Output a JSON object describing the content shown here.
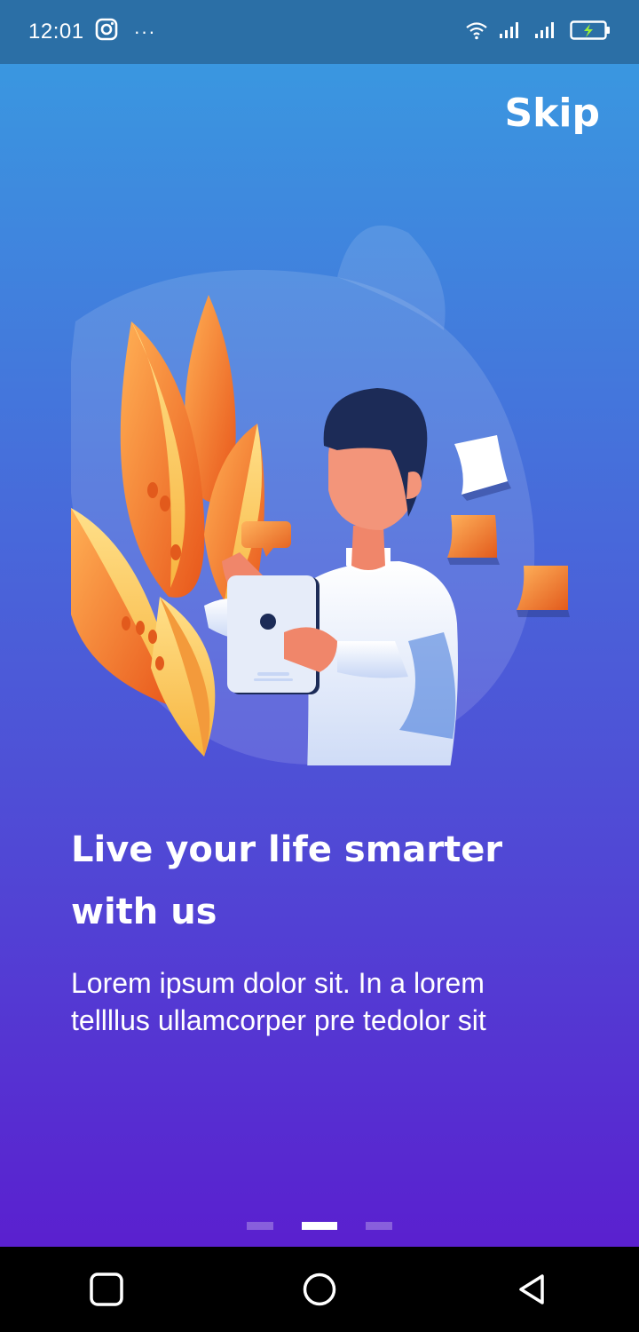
{
  "status_bar": {
    "time": "12:01",
    "overflow": "···",
    "icons": [
      "instagram-icon",
      "wifi-icon",
      "signal-icon",
      "signal-icon",
      "battery-charging-icon"
    ]
  },
  "onboarding": {
    "skip_label": "Skip",
    "headline_line1": "Live your life smarter",
    "headline_line2": "with us",
    "body_line1": "Lorem ipsum dolor sit. In a lorem",
    "body_line2": "tellllus ullamcorper pre tedolor sit",
    "page_count": 3,
    "active_page": 2
  },
  "nav_bar": {
    "buttons": [
      "recents-square-icon",
      "home-circle-icon",
      "back-triangle-icon"
    ]
  },
  "colors": {
    "status_bar_bg": "#2b6fa6",
    "gradient_top": "#3a97e0",
    "gradient_bottom": "#5a20cf",
    "accent_orange": "#f08a3a",
    "text": "#ffffff"
  }
}
